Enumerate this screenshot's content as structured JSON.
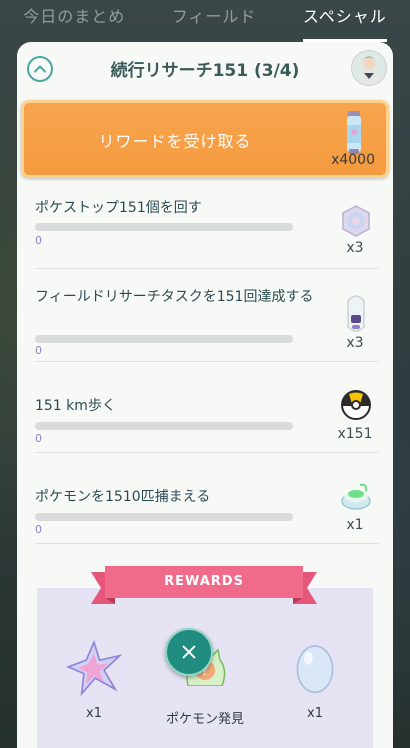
{
  "tabs": [
    {
      "label": "今日のまとめ"
    },
    {
      "label": "フィールド"
    },
    {
      "label": "スペシャル"
    }
  ],
  "research": {
    "title": "続行リサーチ151 (3/4)",
    "reward_button": {
      "label": "リワードを受け取る",
      "count": "x4000",
      "icon": "incense-icon"
    }
  },
  "tasks": [
    {
      "text": "ポケストップ151個を回す",
      "progress": "0",
      "reward_count": "x3",
      "icon": "hexagon-item-icon"
    },
    {
      "text": "フィールドリサーチタスクを151回達成する",
      "progress": "0",
      "reward_count": "x3",
      "icon": "capsule-item-icon"
    },
    {
      "text": "151 km歩く",
      "progress": "0",
      "reward_count": "x151",
      "icon": "ultra-ball-icon"
    },
    {
      "text": "ポケモンを1510匹捕まえる",
      "progress": "0",
      "reward_count": "x1",
      "icon": "lure-module-icon"
    }
  ],
  "rewards": {
    "header": "REWARDS",
    "items": [
      {
        "label": "x1",
        "icon": "star-piece-icon"
      },
      {
        "label": "ポケモン発見",
        "icon": "pokemon-encounter-icon"
      },
      {
        "label": "x1",
        "icon": "egg-icon"
      }
    ]
  },
  "colors": {
    "accent": "#4aa7a0",
    "reward_button": "#f49a3e",
    "ribbon": "#f06b8a",
    "rewards_bg": "#e6e3f4"
  }
}
